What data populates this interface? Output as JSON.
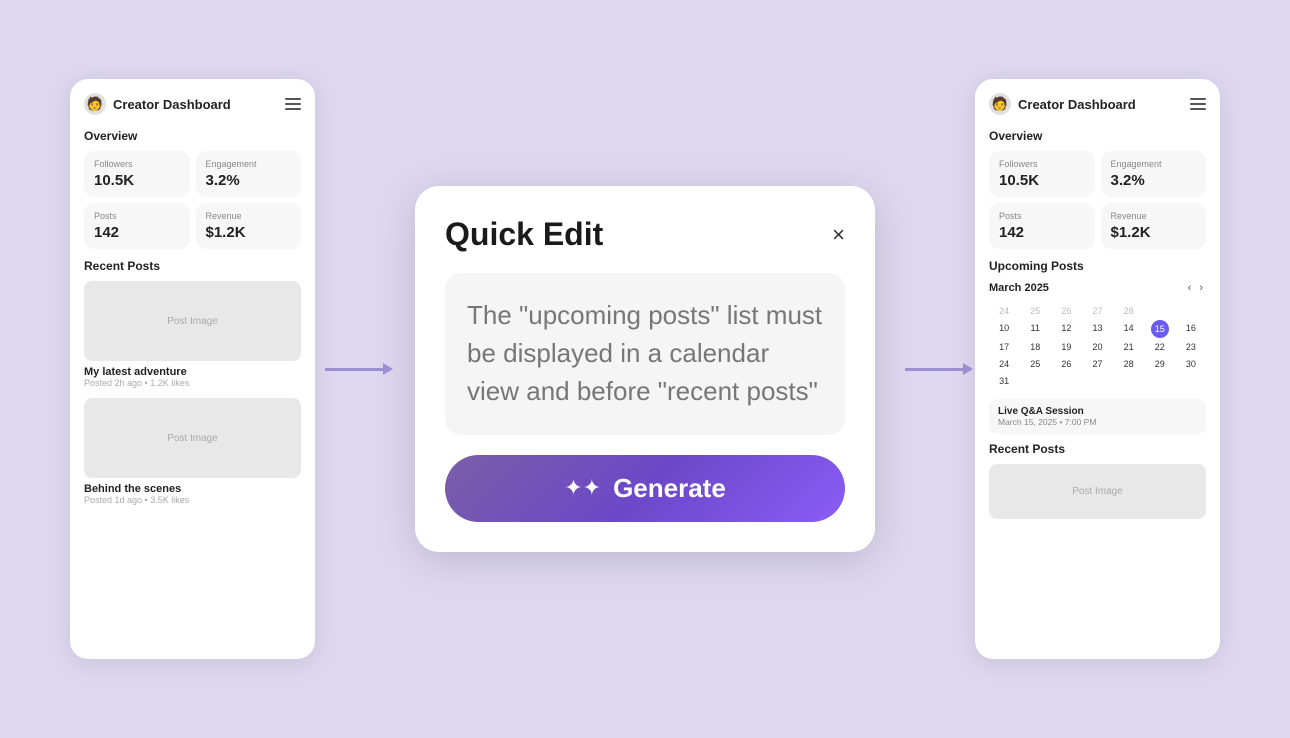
{
  "left_dashboard": {
    "title": "Creator Dashboard",
    "overview_title": "Overview",
    "stats": [
      {
        "label": "Followers",
        "value": "10.5K"
      },
      {
        "label": "Engagement",
        "value": "3.2%"
      },
      {
        "label": "Posts",
        "value": "142"
      },
      {
        "label": "Revenue",
        "value": "$1.2K"
      }
    ],
    "recent_posts_title": "Recent Posts",
    "posts": [
      {
        "title": "My latest adventure",
        "meta": "Posted 2h ago • 1.2K likes",
        "image_label": "Post Image"
      },
      {
        "title": "Behind the scenes",
        "meta": "Posted 1d ago • 3.5K likes",
        "image_label": "Post Image"
      }
    ]
  },
  "modal": {
    "title": "Quick Edit",
    "close_label": "×",
    "text": "The \"upcoming posts\" list must be displayed in a calendar view and before \"recent posts\"",
    "generate_label": "Generate",
    "sparkle": "✦✦"
  },
  "right_dashboard": {
    "title": "Creator Dashboard",
    "overview_title": "Overview",
    "stats": [
      {
        "label": "Followers",
        "value": "10.5K"
      },
      {
        "label": "Engagement",
        "value": "3.2%"
      },
      {
        "label": "Posts",
        "value": "142"
      },
      {
        "label": "Revenue",
        "value": "$1.2K"
      }
    ],
    "upcoming_posts_title": "Upcoming Posts",
    "calendar": {
      "month": "March 2025",
      "weeks": [
        [
          "24",
          "25",
          "26",
          "27",
          "28",
          "",
          ""
        ],
        [
          "",
          "",
          "",
          "",
          "",
          "",
          ""
        ],
        [
          "10",
          "11",
          "12",
          "13",
          "14",
          "15",
          "16"
        ],
        [
          "17",
          "18",
          "19",
          "20",
          "21",
          "22",
          "23"
        ],
        [
          "24",
          "25",
          "26",
          "27",
          "28",
          "29",
          "30"
        ],
        [
          "31",
          "",
          "",
          "",
          "",
          "",
          ""
        ]
      ],
      "today": "15"
    },
    "event": {
      "title": "Live Q&A Session",
      "meta": "March 15, 2025 • 7:00 PM"
    },
    "recent_posts_title": "Recent Posts",
    "posts": [
      {
        "image_label": "Post Image"
      }
    ]
  }
}
